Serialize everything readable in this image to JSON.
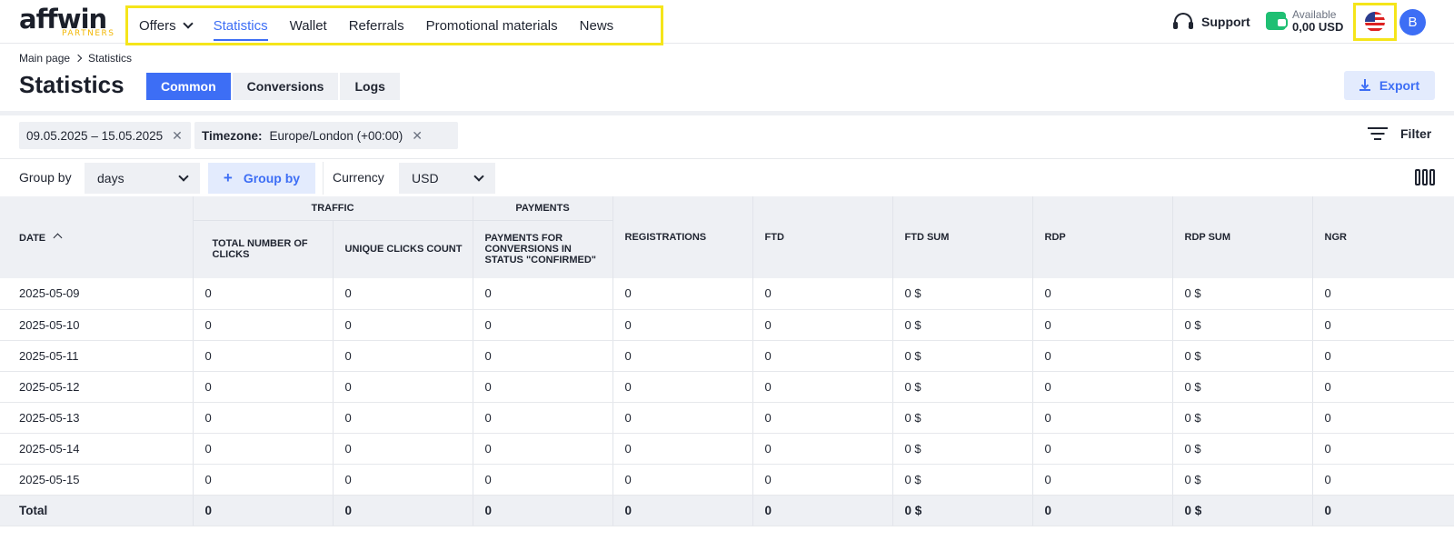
{
  "brand": {
    "word": "affwin",
    "sub": "PARTNERS"
  },
  "nav": {
    "items": [
      {
        "label": "Offers"
      },
      {
        "label": "Statistics"
      },
      {
        "label": "Wallet"
      },
      {
        "label": "Referrals"
      },
      {
        "label": "Promotional materials"
      },
      {
        "label": "News"
      }
    ],
    "active": "Statistics"
  },
  "header": {
    "support": "Support",
    "available_label": "Available",
    "available_amount": "0,00 USD",
    "avatar_initial": "B"
  },
  "breadcrumb": {
    "home": "Main page",
    "current": "Statistics"
  },
  "page": {
    "title": "Statistics",
    "tabs": [
      "Common",
      "Conversions",
      "Logs"
    ],
    "active_tab": "Common",
    "export": "Export"
  },
  "filters": {
    "date_range": "09.05.2025 – 15.05.2025",
    "timezone_label": "Timezone:",
    "timezone_value": "Europe/London (+00:00)",
    "filter_label": "Filter",
    "group_by_label": "Group by",
    "group_by_value": "days",
    "group_by_button": "Group by",
    "currency_label": "Currency",
    "currency_value": "USD"
  },
  "table": {
    "groups": {
      "traffic": "TRAFFIC",
      "payments": "PAYMENTS"
    },
    "columns": [
      "DATE",
      "TOTAL NUMBER OF CLICKS",
      "UNIQUE CLICKS COUNT",
      "PAYMENTS FOR CONVERSIONS IN STATUS \"CONFIRMED\"",
      "REGISTRATIONS",
      "FTD",
      "FTD SUM",
      "RDP",
      "RDP SUM",
      "NGR"
    ],
    "rows": [
      [
        "2025-05-09",
        "0",
        "0",
        "0",
        "0",
        "0",
        "0 $",
        "0",
        "0 $",
        "0"
      ],
      [
        "2025-05-10",
        "0",
        "0",
        "0",
        "0",
        "0",
        "0 $",
        "0",
        "0 $",
        "0"
      ],
      [
        "2025-05-11",
        "0",
        "0",
        "0",
        "0",
        "0",
        "0 $",
        "0",
        "0 $",
        "0"
      ],
      [
        "2025-05-12",
        "0",
        "0",
        "0",
        "0",
        "0",
        "0 $",
        "0",
        "0 $",
        "0"
      ],
      [
        "2025-05-13",
        "0",
        "0",
        "0",
        "0",
        "0",
        "0 $",
        "0",
        "0 $",
        "0"
      ],
      [
        "2025-05-14",
        "0",
        "0",
        "0",
        "0",
        "0",
        "0 $",
        "0",
        "0 $",
        "0"
      ],
      [
        "2025-05-15",
        "0",
        "0",
        "0",
        "0",
        "0",
        "0 $",
        "0",
        "0 $",
        "0"
      ]
    ],
    "total": [
      "Total",
      "0",
      "0",
      "0",
      "0",
      "0",
      "0 $",
      "0",
      "0 $",
      "0"
    ]
  },
  "icons": [
    "chevron-down-icon",
    "headset-icon",
    "wallet-icon",
    "us-flag-icon",
    "chevron-right-icon",
    "download-icon",
    "close-icon",
    "filter-icon",
    "plus-icon",
    "columns-icon",
    "sort-asc-icon"
  ],
  "colors": {
    "accent": "#3d6ef5",
    "highlight": "#f5e51a",
    "wallet": "#1fbf73"
  }
}
